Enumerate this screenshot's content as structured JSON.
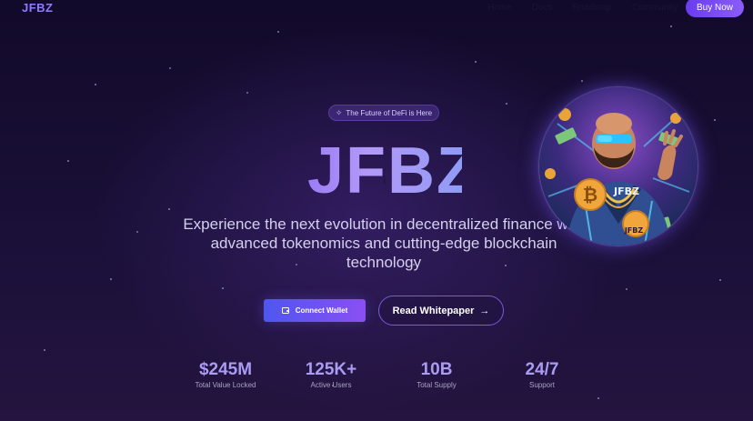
{
  "header": {
    "logo": "JFBZ",
    "nav": [
      "Home",
      "Docs",
      "Roadmap",
      "Community"
    ],
    "buy_button": "Buy Now"
  },
  "hero": {
    "badge_text": "The Future of DeFi is Here",
    "badge_icon": "sparkle-icon",
    "title": "JFBZ",
    "subtitle": "Experience the next evolution in decentralized finance with advanced tokenomics and cutting-edge blockchain technology",
    "connect_wallet": "Connect Wallet",
    "connect_icon": "wallet-icon",
    "read_whitepaper": "Read Whitepaper",
    "whitepaper_icon": "arrow-right-icon",
    "avatar_label": "JFBZ",
    "avatar_coin_label": "JFBZ"
  },
  "stats": [
    {
      "value": "$245M",
      "label": "Total Value Locked"
    },
    {
      "value": "125K+",
      "label": "Active Users"
    },
    {
      "value": "10B",
      "label": "Total Supply"
    },
    {
      "value": "24/7",
      "label": "Support"
    }
  ],
  "colors": {
    "background": "#130b2c",
    "accent": "#8b5cf6",
    "accent_blue": "#4f56f0",
    "stat_value": "#a99cf2"
  }
}
